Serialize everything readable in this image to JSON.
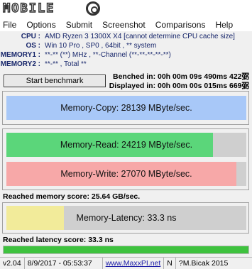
{
  "logo": {
    "text": "MOBILE"
  },
  "menu": [
    "File",
    "Options",
    "Submit",
    "Screenshot",
    "Comparisons",
    "Help"
  ],
  "info": [
    {
      "key": "CPU :",
      "value": "AMD Ryzen 3 1300X X4  [cannot determine CPU cache size]"
    },
    {
      "key": "OS :",
      "value": "Win 10 Pro , SP0 , 64bit , ** system"
    },
    {
      "key": "MEMORY1 :",
      "value": "**-** (**) MHz , **-Channel (**-**-**-**-**)"
    },
    {
      "key": "MEMORY2 :",
      "value": "**-** , Total **"
    }
  ],
  "toolbar": {
    "start_label": "Start benchmark"
  },
  "times": {
    "benched": "Benched in: 00h 00m 09s 490ms 422弼",
    "displayed": "Displayed in: 00h 00m 00s 015ms 669弼"
  },
  "bars": {
    "copy": {
      "label": "Memory-Copy: 28139 MByte/sec.",
      "fill": 1.0,
      "color": "#a8c8f8"
    },
    "read": {
      "label": "Memory-Read: 24219 MByte/sec.",
      "fill": 0.86,
      "color": "#5bd67a"
    },
    "write": {
      "label": "Memory-Write: 27070 MByte/sec.",
      "fill": 0.96,
      "color": "#f7a8a8"
    },
    "latency": {
      "label": "Memory-Latency: 33.3 ns",
      "fill": 0.24,
      "color": "#f2eb9a"
    },
    "progress": {
      "fill": 1.0,
      "color": "#3ec23e"
    }
  },
  "scores": {
    "memory": "Reached memory score: 25.64 GB/sec.",
    "latency": "Reached latency score: 33.3 ns"
  },
  "status": {
    "version": "v2.04",
    "datetime": "8/9/2017 - 05:53:37",
    "url": "www.MaxxPI.net",
    "flag": "N",
    "author": "?M.Bicak 2015"
  }
}
